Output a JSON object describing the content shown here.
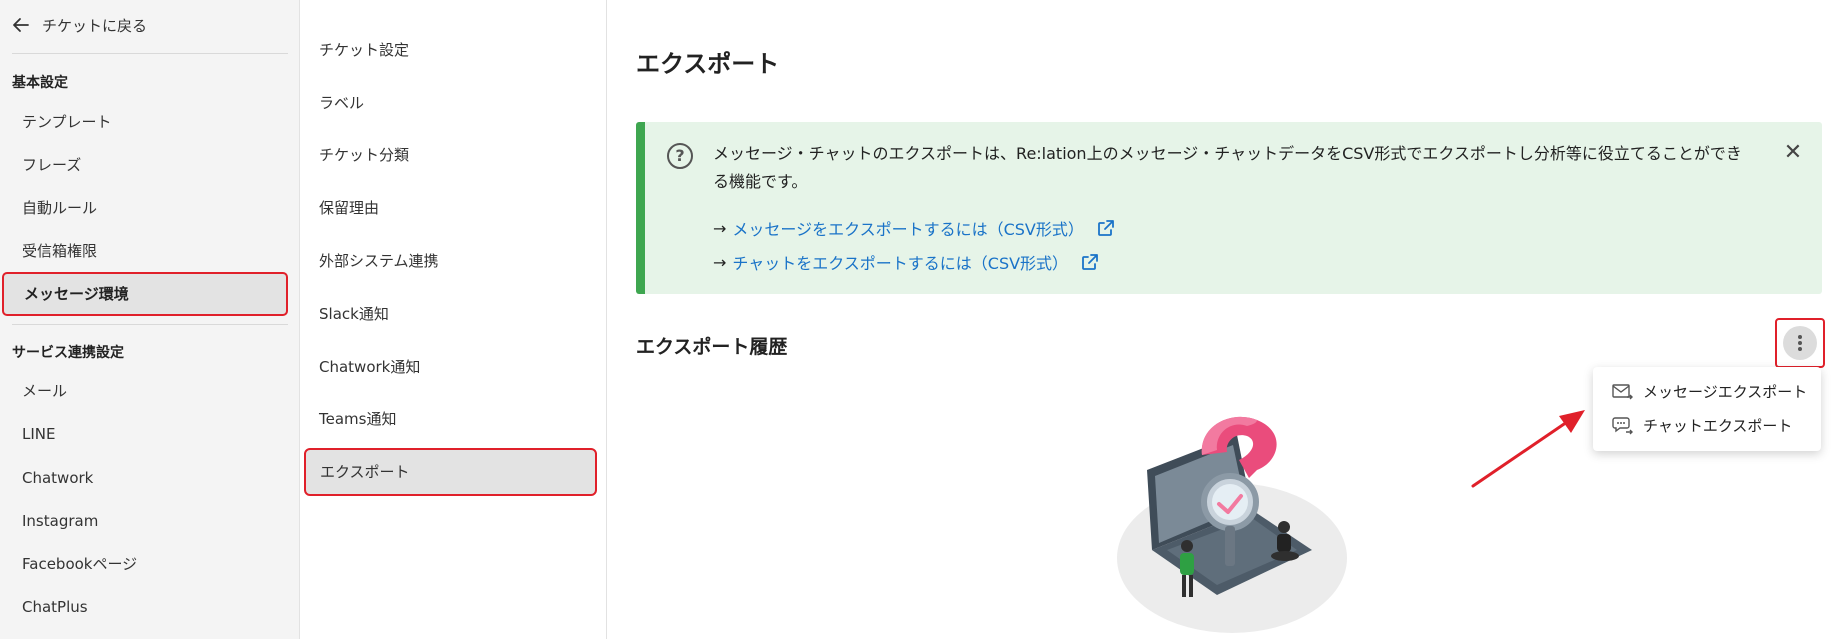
{
  "sidebar": {
    "back_label": "チケットに戻る",
    "section_basic": "基本設定",
    "basic_items": [
      "テンプレート",
      "フレーズ",
      "自動ルール",
      "受信箱権限"
    ],
    "active_item": "メッセージ環境",
    "section_service": "サービス連携設定",
    "service_items": [
      "メール",
      "LINE",
      "Chatwork",
      "Instagram",
      "Facebookページ",
      "ChatPlus"
    ]
  },
  "midnav": {
    "items": [
      "チケット設定",
      "ラベル",
      "チケット分類",
      "保留理由",
      "外部システム連携",
      "Slack通知",
      "Chatwork通知",
      "Teams通知"
    ],
    "active_item": "エクスポート"
  },
  "main": {
    "title": "エクスポート",
    "info": {
      "text": "メッセージ・チャットのエクスポートは、Re:lation上のメッセージ・チャットデータをCSV形式でエクスポートし分析等に役立てることができる機能です。",
      "link_arrow": "→",
      "link1": "メッセージをエクスポートするには（CSV形式）",
      "link2": "チャットをエクスポートするには（CSV形式）"
    },
    "history_title": "エクスポート履歴",
    "menu": {
      "message_export": "メッセージエクスポート",
      "chat_export": "チャットエクスポート"
    }
  },
  "colors": {
    "highlight_border": "#e0202a",
    "info_bg": "#e6f4e8",
    "info_accent": "#3ea650",
    "link": "#1a73c8"
  }
}
